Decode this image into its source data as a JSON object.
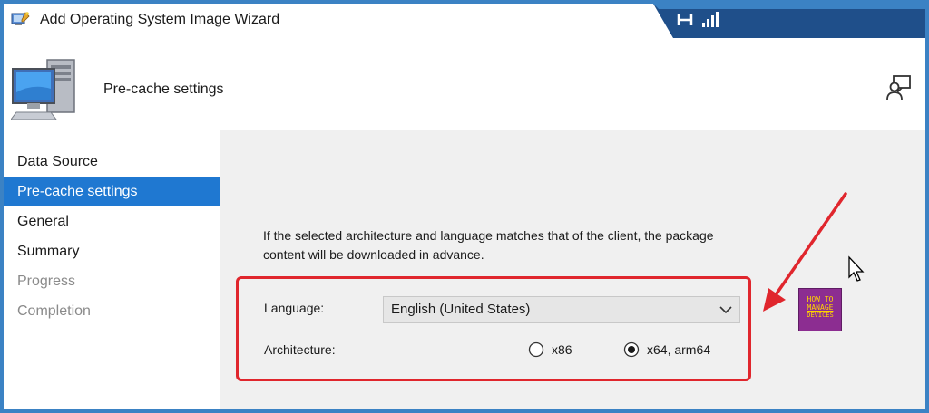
{
  "window": {
    "title": "Add Operating System Image Wizard",
    "page_heading": "Pre-cache settings"
  },
  "sidebar": {
    "items": [
      {
        "label": "Data Source",
        "state": "normal"
      },
      {
        "label": "Pre-cache settings",
        "state": "active"
      },
      {
        "label": "General",
        "state": "normal"
      },
      {
        "label": "Summary",
        "state": "normal"
      },
      {
        "label": "Progress",
        "state": "disabled"
      },
      {
        "label": "Completion",
        "state": "disabled"
      }
    ]
  },
  "content": {
    "description_line1": "If the selected architecture and language matches that of the client, the package",
    "description_line2": "content will be downloaded in advance.",
    "language_label": "Language:",
    "language_value": "English (United States)",
    "architecture_label": "Architecture:",
    "arch_options": [
      {
        "label": "x86",
        "selected": false
      },
      {
        "label": "x64, arm64",
        "selected": true
      }
    ]
  },
  "logo": {
    "line1": "HOW TO",
    "line2": "MANAGE",
    "line3": "DEVICES"
  },
  "colors": {
    "accent": "#1f78d1",
    "highlight": "#e0262d",
    "tray": "#1f4f8a",
    "logo_bg": "#8c2d91",
    "logo_text": "#ffd400"
  },
  "icons": [
    "wizard-icon",
    "computer-icon",
    "help-feedback-icon",
    "chevron-down-icon",
    "radio-unselected-icon",
    "radio-selected-icon",
    "network-icon",
    "signal-icon",
    "mouse-cursor-icon",
    "arrow-annotation-icon"
  ]
}
